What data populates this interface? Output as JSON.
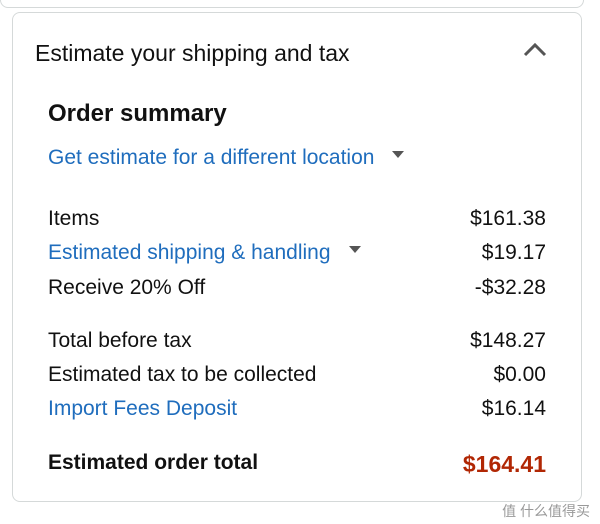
{
  "header": {
    "title": "Estimate your shipping and tax",
    "collapse_icon": "chevron-up-icon"
  },
  "summary": {
    "title": "Order summary",
    "location_link": "Get estimate for a different location",
    "rows": [
      {
        "label": "Items",
        "value": "$161.38"
      },
      {
        "label": "Estimated shipping & handling",
        "value": "$19.17"
      },
      {
        "label": "Receive 20% Off",
        "value": "-$32.28"
      },
      {
        "label": "Total before tax",
        "value": "$148.27"
      },
      {
        "label": "Estimated tax to be collected",
        "value": "$0.00"
      },
      {
        "label": "Import Fees Deposit",
        "value": "$16.14"
      }
    ],
    "total": {
      "label": "Estimated order total",
      "value": "$164.41"
    }
  },
  "watermark": "值 什么值得买",
  "colors": {
    "link": "#1f6dbd",
    "total_price": "#b12704",
    "border": "#d5d9d9"
  }
}
